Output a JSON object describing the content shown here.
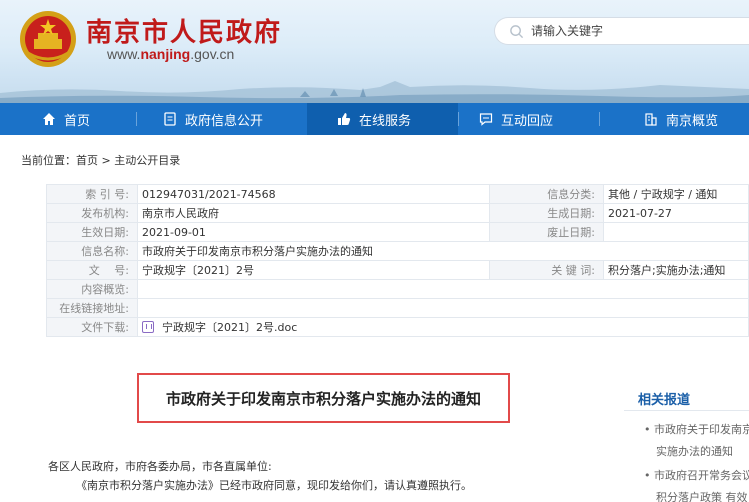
{
  "header": {
    "site_title": "南京市人民政府",
    "url_prefix": "www.",
    "url_domain": "nanjing",
    "url_suffix": ".gov.cn",
    "search_placeholder": "请输入关键字"
  },
  "nav": {
    "items": [
      {
        "label": "首页",
        "icon": "home-icon"
      },
      {
        "label": "政府信息公开",
        "icon": "document-icon"
      },
      {
        "label": "在线服务",
        "icon": "thumbs-up-icon",
        "active": true
      },
      {
        "label": "互动回应",
        "icon": "chat-icon"
      },
      {
        "label": "南京概览",
        "icon": "building-icon"
      }
    ]
  },
  "breadcrumb": {
    "prefix": "当前位置：",
    "home": "首页",
    "sep": " > ",
    "current": "主动公开目录"
  },
  "meta": {
    "index_label": "索 引 号:",
    "index_value": "012947031/2021-74568",
    "category_label": "信息分类:",
    "category_value": "其他 / 宁政规字 / 通知",
    "publisher_label": "发布机构:",
    "publisher_value": "南京市人民政府",
    "created_label": "生成日期:",
    "created_value": "2021-07-27",
    "effective_label": "生效日期:",
    "effective_value": "2021-09-01",
    "expired_label": "废止日期:",
    "expired_value": "",
    "name_label": "信息名称:",
    "name_value": "市政府关于印发南京市积分落户实施办法的通知",
    "docno_label": "文　 号:",
    "docno_value": "宁政规字〔2021〕2号",
    "keywords_label": "关 键 词:",
    "keywords_value": "积分落户;实施办法;通知",
    "summary_label": "内容概览:",
    "summary_value": "",
    "link_label": "在线链接地址:",
    "link_value": "",
    "download_label": "文件下载:",
    "download_value": "宁政规字〔2021〕2号.doc"
  },
  "content": {
    "title": "市政府关于印发南京市积分落户实施办法的通知",
    "salutation": "各区人民政府，市府各委办局，市各直属单位:",
    "paragraph1": "《南京市积分落户实施办法》已经市政府同意，现印发给你们，请认真遵照执行。"
  },
  "related": {
    "title": "相关报道",
    "items": [
      {
        "line1": "• 市政府关于印发南京",
        "line2": "实施办法的通知"
      },
      {
        "line1": "• 市政府召开常务会议",
        "line2": "积分落户政策 有效"
      }
    ]
  },
  "colors": {
    "nav_bg": "#1b72c8",
    "brand_red": "#c01a1a",
    "title_box_border": "#e24a4a"
  }
}
